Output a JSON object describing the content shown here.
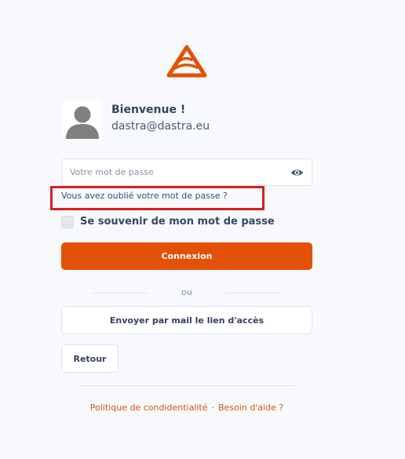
{
  "brand": {
    "logo_icon": "mountain-triangle-logo-icon",
    "accent_color": "#e35106"
  },
  "user": {
    "avatar_icon": "user-silhouette-icon",
    "greeting": "Bienvenue !",
    "email": "dastra@dastra.eu"
  },
  "password": {
    "placeholder": "Votre mot de passe",
    "value": "",
    "toggle_icon": "eye-icon"
  },
  "forgot_password_link": "Vous avez oublié votre mot de passe ?",
  "remember_me": {
    "label": "Se souvenir de mon mot de passe",
    "checked": false
  },
  "login_button": "Connexion",
  "separator_text": "ou",
  "send_mail_button": "Envoyer par mail le lien d'accès",
  "back_button": "Retour",
  "footer": {
    "privacy_link": "Politique de condidentialité",
    "separator": "·",
    "help_link": "Besoin d'aide ?"
  },
  "highlight_color": "#d81f1f"
}
